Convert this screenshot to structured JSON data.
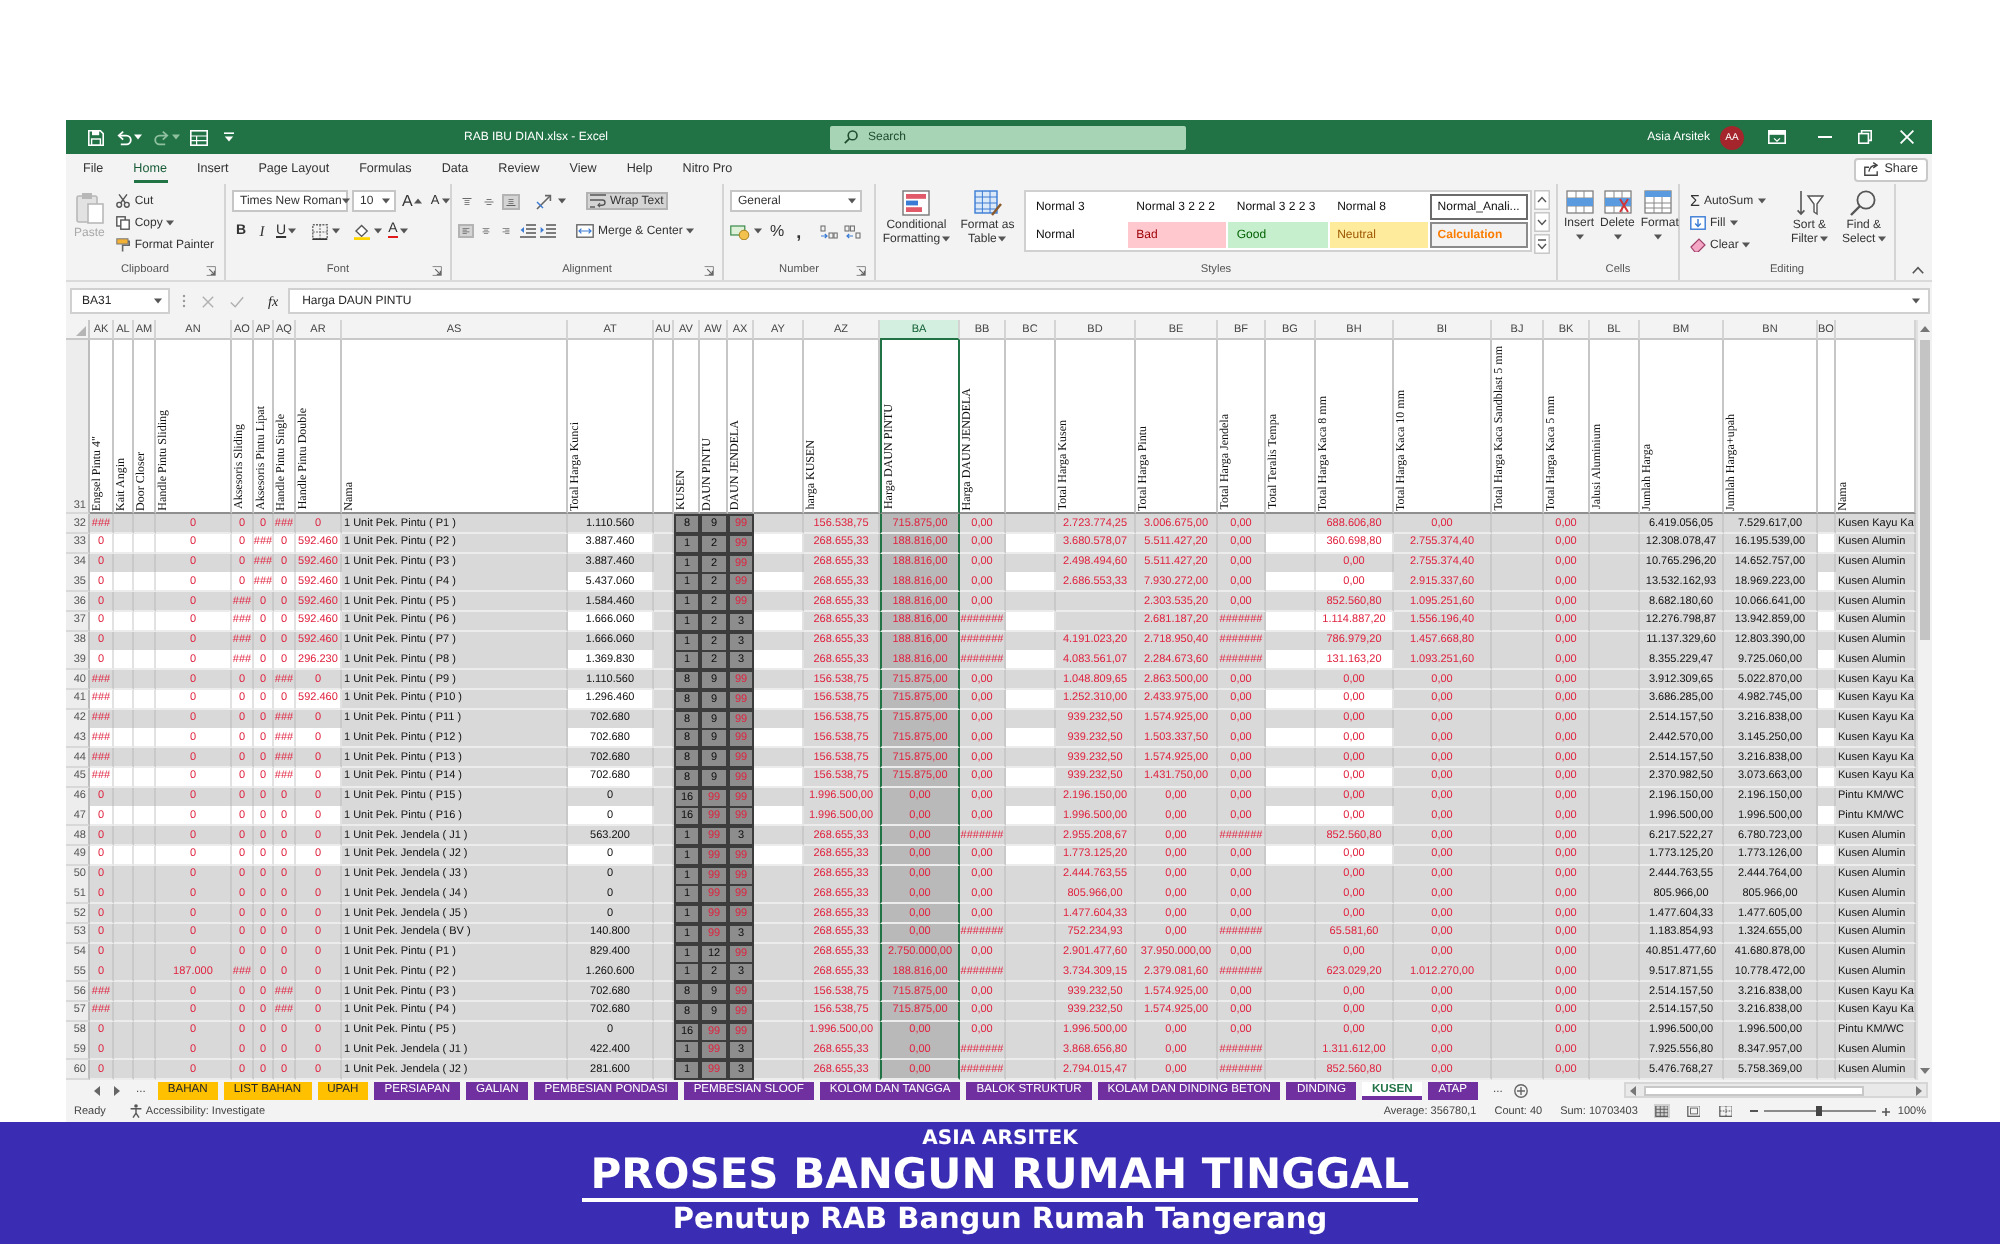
{
  "title_bar": {
    "title": "RAB IBU DIAN.xlsx - Excel",
    "search": {
      "placeholder": "Search"
    },
    "user_name": "Asia Arsitek",
    "avatar_initials": "AA"
  },
  "ribbon_tabs": [
    {
      "label": "File",
      "selected": false
    },
    {
      "label": "Home",
      "selected": true
    },
    {
      "label": "Insert",
      "selected": false
    },
    {
      "label": "Page Layout",
      "selected": false
    },
    {
      "label": "Formulas",
      "selected": false
    },
    {
      "label": "Data",
      "selected": false
    },
    {
      "label": "Review",
      "selected": false
    },
    {
      "label": "View",
      "selected": false
    },
    {
      "label": "Help",
      "selected": false
    },
    {
      "label": "Nitro Pro",
      "selected": false
    }
  ],
  "share_button": "Share",
  "ribbon": {
    "clipboard": {
      "paste": {
        "label": "Paste",
        "disabled": true
      },
      "cut": "Cut",
      "copy": "Copy",
      "format_painter": "Format Painter",
      "label": "Clipboard"
    },
    "font": {
      "font_name": "Times New Roman",
      "font_size": "10",
      "grow_font": "A",
      "shrink_font": "A",
      "bold": "B",
      "italic": "I",
      "underline": "U",
      "font_color": "A",
      "label": "Font"
    },
    "alignment": {
      "vertical_align": [
        {
          "on": false
        },
        {
          "on": false
        },
        {
          "on": true
        }
      ],
      "horizontal_align": [
        {
          "on": true
        },
        {
          "on": false
        },
        {
          "on": false
        }
      ],
      "wrap_text": {
        "label": "Wrap Text",
        "on": true
      },
      "merge_center": "Merge & Center",
      "label": "Alignment"
    },
    "number": {
      "format": "General",
      "percent": "%",
      "comma": ",",
      "label": "Number"
    },
    "styles": {
      "conditional_formatting": "Conditional Formatting",
      "format_as_table": "Format as Table",
      "gallery": [
        {
          "label": "Normal 3",
          "kind": "normal",
          "selected": false
        },
        {
          "label": "Normal 3 2 2 2",
          "kind": "normal",
          "selected": false
        },
        {
          "label": "Normal 3 2 2 3",
          "kind": "normal",
          "selected": false
        },
        {
          "label": "Normal 8",
          "kind": "normal",
          "selected": false
        },
        {
          "label": "Normal_Anali...",
          "kind": "normal",
          "selected": true
        },
        {
          "label": "Normal",
          "kind": "normal",
          "selected": false
        },
        {
          "label": "Bad",
          "kind": "bad",
          "selected": false
        },
        {
          "label": "Good",
          "kind": "good",
          "selected": false
        },
        {
          "label": "Neutral",
          "kind": "neutral",
          "selected": false
        },
        {
          "label": "Calculation",
          "kind": "calculation",
          "selected": false
        }
      ],
      "label": "Styles"
    },
    "cells": {
      "insert": "Insert",
      "delete": "Delete",
      "format": "Format",
      "label": "Cells"
    },
    "editing": {
      "autosum": {
        "symbol": "Σ",
        "label": "AutoSum"
      },
      "fill": "Fill",
      "clear": "Clear",
      "sort_filter": "Sort & Filter",
      "find_select": "Find & Select",
      "label": "Editing"
    }
  },
  "formula_bar": {
    "name_box": "BA31",
    "function_label": "fx",
    "content": "Harga DAUN PINTU"
  },
  "sheet": {
    "header_row_number": "31",
    "columns": [
      {
        "letter": "AK",
        "header": "Engsel Pintu 4\"",
        "kind": "red_number",
        "selected": false,
        "striped": true
      },
      {
        "letter": "AL",
        "header": "Kait Angin",
        "kind": "blank",
        "selected": false,
        "striped": true
      },
      {
        "letter": "AM",
        "header": "Door Closer",
        "kind": "blank",
        "selected": false,
        "striped": true
      },
      {
        "letter": "AN",
        "header": "Handle Pintu Sliding",
        "kind": "red_number",
        "selected": false,
        "striped": true
      },
      {
        "letter": "AO",
        "header": "Aksesoris Sliding",
        "kind": "red_number",
        "selected": false,
        "striped": true
      },
      {
        "letter": "AP",
        "header": "Aksesoris Pintu Lipat",
        "kind": "red_number",
        "selected": false,
        "striped": true
      },
      {
        "letter": "AQ",
        "header": "Handle Pintu Single",
        "kind": "red_number",
        "selected": false,
        "striped": true
      },
      {
        "letter": "AR",
        "header": "Handle Pintu Double",
        "kind": "red_number",
        "selected": false,
        "striped": true
      },
      {
        "letter": "AS",
        "header": "Nama",
        "kind": "text",
        "selected": false,
        "striped": false
      },
      {
        "letter": "AT",
        "header": "Total Harga Kunci",
        "kind": "black_number",
        "selected": false,
        "striped": true
      },
      {
        "letter": "AU",
        "kind": "blank",
        "selected": false,
        "striped": false
      },
      {
        "letter": "AV",
        "header": "KUSEN",
        "kind": "code",
        "selected": false,
        "striped": false
      },
      {
        "letter": "AW",
        "header": "DAUN PINTU",
        "kind": "code",
        "selected": false,
        "striped": false
      },
      {
        "letter": "AX",
        "header": "DAUN JENDELA",
        "kind": "code",
        "selected": false,
        "striped": false
      },
      {
        "letter": "AY",
        "kind": "blank",
        "selected": false,
        "striped": true
      },
      {
        "letter": "AZ",
        "header": "harga KUSEN",
        "kind": "red_number",
        "selected": false,
        "striped": false
      },
      {
        "letter": "BA",
        "header": "Harga DAUN PINTU",
        "kind": "red_number",
        "selected": true,
        "striped": false
      },
      {
        "letter": "BB",
        "header": "Harga DAUN JENDELA",
        "kind": "red_number",
        "selected": false,
        "striped": false
      },
      {
        "letter": "BC",
        "kind": "blank",
        "selected": false,
        "striped": true
      },
      {
        "letter": "BD",
        "header": "Total Harga Kusen",
        "kind": "red_number",
        "selected": false,
        "striped": false
      },
      {
        "letter": "BE",
        "header": "Total Harga Pintu",
        "kind": "red_number",
        "selected": false,
        "striped": false
      },
      {
        "letter": "BF",
        "header": "Total Harga Jendela",
        "kind": "red_number",
        "selected": false,
        "striped": false
      },
      {
        "letter": "BG",
        "header": "Total Teralis Tempa",
        "kind": "blank",
        "selected": false,
        "striped": true
      },
      {
        "letter": "BH",
        "header": "Total Harga Kaca 8 mm",
        "kind": "red_number",
        "selected": false,
        "striped": true
      },
      {
        "letter": "BI",
        "header": "Total Harga Kaca 10 mm",
        "kind": "red_number",
        "selected": false,
        "striped": false
      },
      {
        "letter": "BJ",
        "header": "Total Harga Kaca Sandblast 5 mm",
        "kind": "blank",
        "selected": false,
        "striped": false
      },
      {
        "letter": "BK",
        "header": "Total Harga Kaca 5 mm",
        "kind": "red_number",
        "selected": false,
        "striped": false
      },
      {
        "letter": "BL",
        "header": "Jalusi Aluminium",
        "kind": "blank",
        "selected": false,
        "striped": false
      },
      {
        "letter": "BM",
        "header": "Jumlah Harga",
        "kind": "black_number",
        "selected": false,
        "striped": false
      },
      {
        "letter": "BN",
        "header": "Jumlah Harga+upah",
        "kind": "black_number",
        "selected": false,
        "striped": false
      },
      {
        "letter": "BO",
        "kind": "blank",
        "selected": false,
        "striped": true
      },
      {
        "header": "Nama",
        "kind": "text",
        "selected": false,
        "striped": false
      }
    ],
    "rows": [
      {
        "number": "32",
        "striped": false,
        "cells": [
          "###",
          "",
          "",
          "0",
          "0",
          "0",
          "###",
          "0",
          "1 Unit Pek. Pintu ( P1 )",
          "1.110.560",
          "",
          {
            "text": "8",
            "alert": false
          },
          {
            "text": "9",
            "alert": false
          },
          {
            "text": "99",
            "alert": true
          },
          "",
          "156.538,75",
          "715.875,00",
          "0,00",
          "",
          "2.723.774,25",
          "3.006.675,00",
          "0,00",
          "",
          "688.606,80",
          "0,00",
          "",
          "0,00",
          "",
          "6.419.056,05",
          "7.529.617,00",
          "",
          "Kusen Kayu Ka"
        ]
      },
      {
        "number": "33",
        "striped": true,
        "cells": [
          "0",
          "",
          "",
          "0",
          "0",
          "###",
          "0",
          "592.460",
          "1 Unit Pek. Pintu ( P2 )",
          "3.887.460",
          "",
          {
            "text": "1",
            "alert": false
          },
          {
            "text": "2",
            "alert": false
          },
          {
            "text": "99",
            "alert": true
          },
          "",
          "268.655,33",
          "188.816,00",
          "0,00",
          "",
          "3.680.578,07",
          "5.511.427,20",
          "0,00",
          "",
          "360.698,80",
          "2.755.374,40",
          "",
          "0,00",
          "",
          "12.308.078,47",
          "16.195.539,00",
          "",
          "Kusen Alumin"
        ]
      },
      {
        "number": "34",
        "striped": false,
        "cells": [
          "0",
          "",
          "",
          "0",
          "0",
          "###",
          "0",
          "592.460",
          "1 Unit Pek. Pintu ( P3 )",
          "3.887.460",
          "",
          {
            "text": "1",
            "alert": false
          },
          {
            "text": "2",
            "alert": false
          },
          {
            "text": "99",
            "alert": true
          },
          "",
          "268.655,33",
          "188.816,00",
          "0,00",
          "",
          "2.498.494,60",
          "5.511.427,20",
          "0,00",
          "",
          "0,00",
          "2.755.374,40",
          "",
          "0,00",
          "",
          "10.765.296,20",
          "14.652.757,00",
          "",
          "Kusen Alumin"
        ]
      },
      {
        "number": "35",
        "striped": true,
        "cells": [
          "0",
          "",
          "",
          "0",
          "0",
          "###",
          "0",
          "592.460",
          "1 Unit Pek. Pintu ( P4 )",
          "5.437.060",
          "",
          {
            "text": "1",
            "alert": false
          },
          {
            "text": "2",
            "alert": false
          },
          {
            "text": "99",
            "alert": true
          },
          "",
          "268.655,33",
          "188.816,00",
          "0,00",
          "",
          "2.686.553,33",
          "7.930.272,00",
          "0,00",
          "",
          "0,00",
          "2.915.337,60",
          "",
          "0,00",
          "",
          "13.532.162,93",
          "18.969.223,00",
          "",
          "Kusen Alumin"
        ]
      },
      {
        "number": "36",
        "striped": false,
        "cells": [
          "0",
          "",
          "",
          "0",
          "###",
          "0",
          "0",
          "592.460",
          "1 Unit Pek. Pintu ( P5 )",
          "1.584.460",
          "",
          {
            "text": "1",
            "alert": false
          },
          {
            "text": "2",
            "alert": false
          },
          {
            "text": "99",
            "alert": true
          },
          "",
          "268.655,33",
          "188.816,00",
          "0,00",
          "",
          "",
          "2.303.535,20",
          "0,00",
          "",
          "852.560,80",
          "1.095.251,60",
          "",
          "0,00",
          "",
          "8.682.180,60",
          "10.066.641,00",
          "",
          "Kusen Alumin"
        ]
      },
      {
        "number": "37",
        "striped": true,
        "cells": [
          "0",
          "",
          "",
          "0",
          "###",
          "0",
          "0",
          "592.460",
          "1 Unit Pek. Pintu ( P6 )",
          "1.666.060",
          "",
          {
            "text": "1",
            "alert": false
          },
          {
            "text": "2",
            "alert": false
          },
          {
            "text": "3",
            "alert": false
          },
          "",
          "268.655,33",
          "188.816,00",
          "#######",
          "",
          "",
          "2.681.187,20",
          "#######",
          "",
          "1.114.887,20",
          "1.556.196,40",
          "",
          "0,00",
          "",
          "12.276.798,87",
          "13.942.859,00",
          "",
          "Kusen Alumin"
        ]
      },
      {
        "number": "38",
        "striped": false,
        "cells": [
          "0",
          "",
          "",
          "0",
          "###",
          "0",
          "0",
          "592.460",
          "1 Unit Pek. Pintu ( P7 )",
          "1.666.060",
          "",
          {
            "text": "1",
            "alert": false
          },
          {
            "text": "2",
            "alert": false
          },
          {
            "text": "3",
            "alert": false
          },
          "",
          "268.655,33",
          "188.816,00",
          "#######",
          "",
          "4.191.023,20",
          "2.718.950,40",
          "#######",
          "",
          "786.979,20",
          "1.457.668,80",
          "",
          "0,00",
          "",
          "11.137.329,60",
          "12.803.390,00",
          "",
          "Kusen Alumin"
        ]
      },
      {
        "number": "39",
        "striped": true,
        "cells": [
          "0",
          "",
          "",
          "0",
          "###",
          "0",
          "0",
          "296.230",
          "1 Unit Pek. Pintu ( P8 )",
          "1.369.830",
          "",
          {
            "text": "1",
            "alert": false
          },
          {
            "text": "2",
            "alert": false
          },
          {
            "text": "3",
            "alert": false
          },
          "",
          "268.655,33",
          "188.816,00",
          "#######",
          "",
          "4.083.561,07",
          "2.284.673,60",
          "#######",
          "",
          "131.163,20",
          "1.093.251,60",
          "",
          "0,00",
          "",
          "8.355.229,47",
          "9.725.060,00",
          "",
          "Kusen Alumin"
        ]
      },
      {
        "number": "40",
        "striped": false,
        "cells": [
          "###",
          "",
          "",
          "0",
          "0",
          "0",
          "###",
          "0",
          "1 Unit Pek. Pintu ( P9 )",
          "1.110.560",
          "",
          {
            "text": "8",
            "alert": false
          },
          {
            "text": "9",
            "alert": false
          },
          {
            "text": "99",
            "alert": true
          },
          "",
          "156.538,75",
          "715.875,00",
          "0,00",
          "",
          "1.048.809,65",
          "2.863.500,00",
          "0,00",
          "",
          "0,00",
          "0,00",
          "",
          "0,00",
          "",
          "3.912.309,65",
          "5.022.870,00",
          "",
          "Kusen Kayu Ka"
        ]
      },
      {
        "number": "41",
        "striped": true,
        "cells": [
          "###",
          "",
          "",
          "0",
          "0",
          "0",
          "0",
          "592.460",
          "1 Unit Pek. Pintu ( P10 )",
          "1.296.460",
          "",
          {
            "text": "8",
            "alert": false
          },
          {
            "text": "9",
            "alert": false
          },
          {
            "text": "99",
            "alert": true
          },
          "",
          "156.538,75",
          "715.875,00",
          "0,00",
          "",
          "1.252.310,00",
          "2.433.975,00",
          "0,00",
          "",
          "0,00",
          "0,00",
          "",
          "0,00",
          "",
          "3.686.285,00",
          "4.982.745,00",
          "",
          "Kusen Kayu Ka"
        ]
      },
      {
        "number": "42",
        "striped": false,
        "cells": [
          "###",
          "",
          "",
          "0",
          "0",
          "0",
          "###",
          "0",
          "1 Unit Pek. Pintu ( P11 )",
          "702.680",
          "",
          {
            "text": "8",
            "alert": false
          },
          {
            "text": "9",
            "alert": false
          },
          {
            "text": "99",
            "alert": true
          },
          "",
          "156.538,75",
          "715.875,00",
          "0,00",
          "",
          "939.232,50",
          "1.574.925,00",
          "0,00",
          "",
          "0,00",
          "0,00",
          "",
          "0,00",
          "",
          "2.514.157,50",
          "3.216.838,00",
          "",
          "Kusen Kayu Ka"
        ]
      },
      {
        "number": "43",
        "striped": true,
        "cells": [
          "###",
          "",
          "",
          "0",
          "0",
          "0",
          "###",
          "0",
          "1 Unit Pek. Pintu ( P12 )",
          "702.680",
          "",
          {
            "text": "8",
            "alert": false
          },
          {
            "text": "9",
            "alert": false
          },
          {
            "text": "99",
            "alert": true
          },
          "",
          "156.538,75",
          "715.875,00",
          "0,00",
          "",
          "939.232,50",
          "1.503.337,50",
          "0,00",
          "",
          "0,00",
          "0,00",
          "",
          "0,00",
          "",
          "2.442.570,00",
          "3.145.250,00",
          "",
          "Kusen Kayu Ka"
        ]
      },
      {
        "number": "44",
        "striped": false,
        "cells": [
          "###",
          "",
          "",
          "0",
          "0",
          "0",
          "###",
          "0",
          "1 Unit Pek. Pintu ( P13 )",
          "702.680",
          "",
          {
            "text": "8",
            "alert": false
          },
          {
            "text": "9",
            "alert": false
          },
          {
            "text": "99",
            "alert": true
          },
          "",
          "156.538,75",
          "715.875,00",
          "0,00",
          "",
          "939.232,50",
          "1.574.925,00",
          "0,00",
          "",
          "0,00",
          "0,00",
          "",
          "0,00",
          "",
          "2.514.157,50",
          "3.216.838,00",
          "",
          "Kusen Kayu Ka"
        ]
      },
      {
        "number": "45",
        "striped": true,
        "cells": [
          "###",
          "",
          "",
          "0",
          "0",
          "0",
          "###",
          "0",
          "1 Unit Pek. Pintu ( P14 )",
          "702.680",
          "",
          {
            "text": "8",
            "alert": false
          },
          {
            "text": "9",
            "alert": false
          },
          {
            "text": "99",
            "alert": true
          },
          "",
          "156.538,75",
          "715.875,00",
          "0,00",
          "",
          "939.232,50",
          "1.431.750,00",
          "0,00",
          "",
          "0,00",
          "0,00",
          "",
          "0,00",
          "",
          "2.370.982,50",
          "3.073.663,00",
          "",
          "Kusen Kayu Ka"
        ]
      },
      {
        "number": "46",
        "striped": false,
        "cells": [
          "0",
          "",
          "",
          "0",
          "0",
          "0",
          "0",
          "0",
          "1 Unit Pek. Pintu ( P15 )",
          "0",
          "",
          {
            "text": "16",
            "alert": false
          },
          {
            "text": "99",
            "alert": true
          },
          {
            "text": "99",
            "alert": true
          },
          "",
          "1.996.500,00",
          "0,00",
          "0,00",
          "",
          "2.196.150,00",
          "0,00",
          "0,00",
          "",
          "0,00",
          "0,00",
          "",
          "0,00",
          "",
          "2.196.150,00",
          "2.196.150,00",
          "",
          "Pintu KM/WC"
        ]
      },
      {
        "number": "47",
        "striped": true,
        "cells": [
          "0",
          "",
          "",
          "0",
          "0",
          "0",
          "0",
          "0",
          "1 Unit Pek. Pintu ( P16 )",
          "0",
          "",
          {
            "text": "16",
            "alert": false
          },
          {
            "text": "99",
            "alert": true
          },
          {
            "text": "99",
            "alert": true
          },
          "",
          "1.996.500,00",
          "0,00",
          "0,00",
          "",
          "1.996.500,00",
          "0,00",
          "0,00",
          "",
          "0,00",
          "0,00",
          "",
          "0,00",
          "",
          "1.996.500,00",
          "1.996.500,00",
          "",
          "Pintu KM/WC"
        ]
      },
      {
        "number": "48",
        "striped": false,
        "cells": [
          "0",
          "",
          "",
          "0",
          "0",
          "0",
          "0",
          "0",
          "1 Unit Pek. Jendela ( J1 )",
          "563.200",
          "",
          {
            "text": "1",
            "alert": false
          },
          {
            "text": "99",
            "alert": true
          },
          {
            "text": "3",
            "alert": false
          },
          "",
          "268.655,33",
          "0,00",
          "#######",
          "",
          "2.955.208,67",
          "0,00",
          "#######",
          "",
          "852.560,80",
          "0,00",
          "",
          "0,00",
          "",
          "6.217.522,27",
          "6.780.723,00",
          "",
          "Kusen Alumin"
        ]
      },
      {
        "number": "49",
        "striped": true,
        "cells": [
          "0",
          "",
          "",
          "0",
          "0",
          "0",
          "0",
          "0",
          "1 Unit Pek. Jendela ( J2 )",
          "0",
          "",
          {
            "text": "1",
            "alert": false
          },
          {
            "text": "99",
            "alert": true
          },
          {
            "text": "99",
            "alert": true
          },
          "",
          "268.655,33",
          "0,00",
          "0,00",
          "",
          "1.773.125,20",
          "0,00",
          "0,00",
          "",
          "0,00",
          "0,00",
          "",
          "0,00",
          "",
          "1.773.125,20",
          "1.773.126,00",
          "",
          "Kusen Alumin"
        ]
      },
      {
        "number": "50",
        "striped": false,
        "cells": [
          "0",
          "",
          "",
          "0",
          "0",
          "0",
          "0",
          "0",
          "1 Unit Pek. Jendela ( J3 )",
          "0",
          "",
          {
            "text": "1",
            "alert": false
          },
          {
            "text": "99",
            "alert": true
          },
          {
            "text": "99",
            "alert": true
          },
          "",
          "268.655,33",
          "0,00",
          "0,00",
          "",
          "2.444.763,55",
          "0,00",
          "0,00",
          "",
          "0,00",
          "0,00",
          "",
          "0,00",
          "",
          "2.444.763,55",
          "2.444.764,00",
          "",
          "Kusen Alumin"
        ]
      },
      {
        "number": "51",
        "striped": false,
        "cells": [
          "0",
          "",
          "",
          "0",
          "0",
          "0",
          "0",
          "0",
          "1 Unit Pek. Jendela ( J4 )",
          "0",
          "",
          {
            "text": "1",
            "alert": false
          },
          {
            "text": "99",
            "alert": true
          },
          {
            "text": "99",
            "alert": true
          },
          "",
          "268.655,33",
          "0,00",
          "0,00",
          "",
          "805.966,00",
          "0,00",
          "0,00",
          "",
          "0,00",
          "0,00",
          "",
          "0,00",
          "",
          "805.966,00",
          "805.966,00",
          "",
          "Kusen Alumin"
        ]
      },
      {
        "number": "52",
        "striped": false,
        "cells": [
          "0",
          "",
          "",
          "0",
          "0",
          "0",
          "0",
          "0",
          "1 Unit Pek. Jendela ( J5 )",
          "0",
          "",
          {
            "text": "1",
            "alert": false
          },
          {
            "text": "99",
            "alert": true
          },
          {
            "text": "99",
            "alert": true
          },
          "",
          "268.655,33",
          "0,00",
          "0,00",
          "",
          "1.477.604,33",
          "0,00",
          "0,00",
          "",
          "0,00",
          "0,00",
          "",
          "0,00",
          "",
          "1.477.604,33",
          "1.477.605,00",
          "",
          "Kusen Alumin"
        ]
      },
      {
        "number": "53",
        "striped": false,
        "cells": [
          "0",
          "",
          "",
          "0",
          "0",
          "0",
          "0",
          "0",
          "1 Unit Pek. Jendela ( BV )",
          "140.800",
          "",
          {
            "text": "1",
            "alert": false
          },
          {
            "text": "99",
            "alert": true
          },
          {
            "text": "3",
            "alert": false
          },
          "",
          "268.655,33",
          "0,00",
          "#######",
          "",
          "752.234,93",
          "0,00",
          "#######",
          "",
          "65.581,60",
          "0,00",
          "",
          "0,00",
          "",
          "1.183.854,93",
          "1.324.655,00",
          "",
          "Kusen Alumin"
        ]
      },
      {
        "number": "54",
        "striped": false,
        "cells": [
          "0",
          "",
          "",
          "0",
          "0",
          "0",
          "0",
          "0",
          "1 Unit Pek. Pintu ( P1 )",
          "829.400",
          "",
          {
            "text": "1",
            "alert": false
          },
          {
            "text": "12",
            "alert": false
          },
          {
            "text": "99",
            "alert": true
          },
          "",
          "268.655,33",
          "2.750.000,00",
          "0,00",
          "",
          "2.901.477,60",
          "37.950.000,00",
          "0,00",
          "",
          "0,00",
          "0,00",
          "",
          "0,00",
          "",
          "40.851.477,60",
          "41.680.878,00",
          "",
          "Kusen Alumin"
        ]
      },
      {
        "number": "55",
        "striped": false,
        "cells": [
          "0",
          "",
          "",
          "187.000",
          "###",
          "0",
          "0",
          "0",
          "1 Unit Pek. Pintu ( P2 )",
          "1.260.600",
          "",
          {
            "text": "1",
            "alert": false
          },
          {
            "text": "2",
            "alert": false
          },
          {
            "text": "3",
            "alert": false
          },
          "",
          "268.655,33",
          "188.816,00",
          "#######",
          "",
          "3.734.309,15",
          "2.379.081,60",
          "#######",
          "",
          "623.029,20",
          "1.012.270,00",
          "",
          "0,00",
          "",
          "9.517.871,55",
          "10.778.472,00",
          "",
          "Kusen Alumin"
        ]
      },
      {
        "number": "56",
        "striped": false,
        "cells": [
          "###",
          "",
          "",
          "0",
          "0",
          "0",
          "###",
          "0",
          "1 Unit Pek. Pintu ( P3 )",
          "702.680",
          "",
          {
            "text": "8",
            "alert": false
          },
          {
            "text": "9",
            "alert": false
          },
          {
            "text": "99",
            "alert": true
          },
          "",
          "156.538,75",
          "715.875,00",
          "0,00",
          "",
          "939.232,50",
          "1.574.925,00",
          "0,00",
          "",
          "0,00",
          "0,00",
          "",
          "0,00",
          "",
          "2.514.157,50",
          "3.216.838,00",
          "",
          "Kusen Kayu Ka"
        ]
      },
      {
        "number": "57",
        "striped": false,
        "cells": [
          "###",
          "",
          "",
          "0",
          "0",
          "0",
          "###",
          "0",
          "1 Unit Pek. Pintu ( P4 )",
          "702.680",
          "",
          {
            "text": "8",
            "alert": false
          },
          {
            "text": "9",
            "alert": false
          },
          {
            "text": "99",
            "alert": true
          },
          "",
          "156.538,75",
          "715.875,00",
          "0,00",
          "",
          "939.232,50",
          "1.574.925,00",
          "0,00",
          "",
          "0,00",
          "0,00",
          "",
          "0,00",
          "",
          "2.514.157,50",
          "3.216.838,00",
          "",
          "Kusen Kayu Ka"
        ]
      },
      {
        "number": "58",
        "striped": false,
        "cells": [
          "0",
          "",
          "",
          "0",
          "0",
          "0",
          "0",
          "0",
          "1 Unit Pek. Pintu ( P5 )",
          "0",
          "",
          {
            "text": "16",
            "alert": false
          },
          {
            "text": "99",
            "alert": true
          },
          {
            "text": "99",
            "alert": true
          },
          "",
          "1.996.500,00",
          "0,00",
          "0,00",
          "",
          "1.996.500,00",
          "0,00",
          "0,00",
          "",
          "0,00",
          "0,00",
          "",
          "0,00",
          "",
          "1.996.500,00",
          "1.996.500,00",
          "",
          "Pintu KM/WC"
        ]
      },
      {
        "number": "59",
        "striped": false,
        "cells": [
          "0",
          "",
          "",
          "0",
          "0",
          "0",
          "0",
          "0",
          "1 Unit Pek. Jendela ( J1 )",
          "422.400",
          "",
          {
            "text": "1",
            "alert": false
          },
          {
            "text": "99",
            "alert": true
          },
          {
            "text": "3",
            "alert": false
          },
          "",
          "268.655,33",
          "0,00",
          "#######",
          "",
          "3.868.656,80",
          "0,00",
          "#######",
          "",
          "1.311.612,00",
          "0,00",
          "",
          "0,00",
          "",
          "7.925.556,80",
          "8.347.957,00",
          "",
          "Kusen Alumin"
        ]
      },
      {
        "number": "60",
        "striped": false,
        "cells": [
          "0",
          "",
          "",
          "0",
          "0",
          "0",
          "0",
          "0",
          "1 Unit Pek. Jendela ( J2 )",
          "281.600",
          "",
          {
            "text": "1",
            "alert": false
          },
          {
            "text": "99",
            "alert": true
          },
          {
            "text": "3",
            "alert": false
          },
          "",
          "268.655,33",
          "0,00",
          "#######",
          "",
          "2.794.015,47",
          "0,00",
          "#######",
          "",
          "852.560,80",
          "0,00",
          "",
          "0,00",
          "",
          "5.476.768,27",
          "5.758.369,00",
          "",
          "Kusen Alumin"
        ]
      }
    ]
  },
  "sheet_tabs": {
    "more_left": "...",
    "tabs": [
      {
        "label": "BAHAN",
        "color": "#ffc000",
        "selected": false
      },
      {
        "label": "LIST BAHAN",
        "color": "#ffc000",
        "selected": false
      },
      {
        "label": "UPAH",
        "color": "#ffc000",
        "selected": false
      },
      {
        "label": "PERSIAPAN",
        "color": "#7030a0",
        "selected": false
      },
      {
        "label": "GALIAN",
        "color": "#7030a0",
        "selected": false
      },
      {
        "label": "PEMBESIAN PONDASI",
        "color": "#7030a0",
        "selected": false
      },
      {
        "label": "PEMBESIAN SLOOF",
        "color": "#7030a0",
        "selected": false
      },
      {
        "label": "KOLOM DAN TANGGA",
        "color": "#7030a0",
        "selected": false
      },
      {
        "label": "BALOK STRUKTUR",
        "color": "#7030a0",
        "selected": false
      },
      {
        "label": "KOLAM DAN DINDING BETON",
        "color": "#7030a0",
        "selected": false
      },
      {
        "label": "DINDING",
        "color": "#7030a0",
        "selected": false
      },
      {
        "label": "KUSEN",
        "color": "#7030a0",
        "selected": true
      },
      {
        "label": "ATAP",
        "color": "#7030a0",
        "selected": false
      }
    ],
    "more_right": "..."
  },
  "status_bar": {
    "mode": "Ready",
    "accessibility": "Accessibility: Investigate",
    "average": "Average: 356780,1",
    "count": "Count: 40",
    "sum": "Sum: 10703403",
    "views": [
      {
        "selected": true
      },
      {
        "selected": false
      },
      {
        "selected": false
      }
    ],
    "zoom": {
      "level": 0.5,
      "reading": "100%"
    }
  },
  "banner": {
    "brand": "ASIA ARSITEK",
    "title": "PROSES BANGUN RUMAH TINGGAL",
    "subtitle": "Penutup RAB Bangun Rumah Tangerang"
  }
}
